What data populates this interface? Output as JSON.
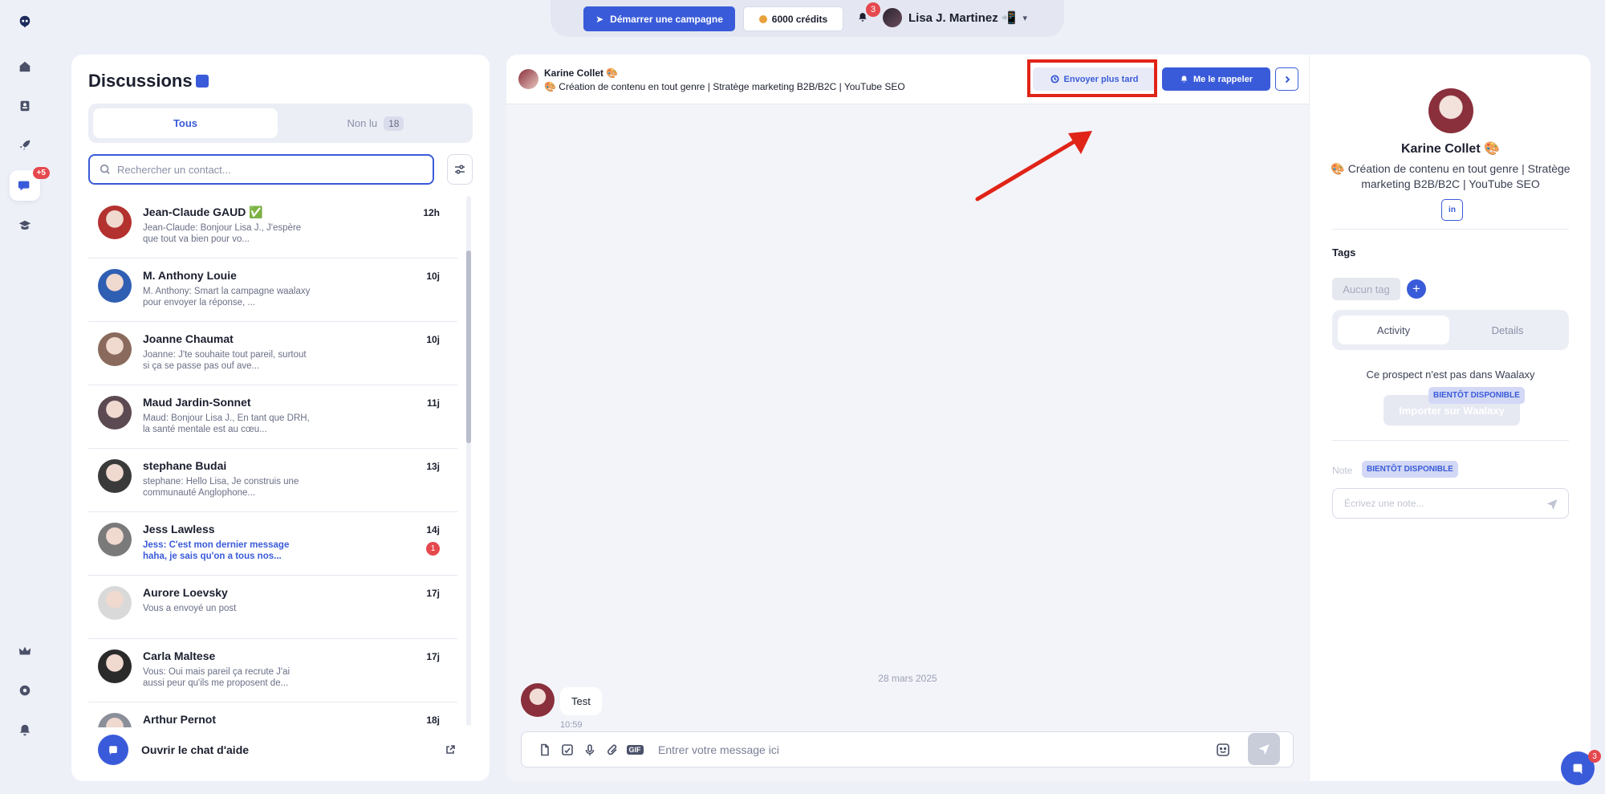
{
  "topbar": {
    "campaign_label": "Démarrer une campagne",
    "credits_label": "6000 crédits",
    "notifications_count": "3",
    "user_name": "Lisa J. Martinez 📲"
  },
  "sidebar": {
    "messages_badge": "+5"
  },
  "discussions": {
    "title": "Discussions",
    "tab_all": "Tous",
    "tab_unread": "Non lu",
    "unread_count": "18",
    "search_placeholder": "Rechercher un contact...",
    "items": [
      {
        "name": "Jean-Claude GAUD ✅",
        "time": "12h",
        "preview": "Jean-Claude: Bonjour Lisa J., J'espère que tout va bien pour vo...",
        "unread": false,
        "badge": "",
        "color": "#b3312f"
      },
      {
        "name": "M. Anthony Louie",
        "time": "10j",
        "preview": "M. Anthony: Smart la campagne waalaxy pour envoyer la réponse, ...",
        "unread": false,
        "badge": "",
        "color": "#2f5fb3"
      },
      {
        "name": "Joanne Chaumat",
        "time": "10j",
        "preview": "Joanne: J'te souhaite tout pareil, surtout si ça se passe pas ouf ave...",
        "unread": false,
        "badge": "",
        "color": "#8a6a5c"
      },
      {
        "name": "Maud Jardin-Sonnet",
        "time": "11j",
        "preview": "Maud: Bonjour Lisa J., En tant que DRH, la santé mentale est au cœu...",
        "unread": false,
        "badge": "",
        "color": "#5c4a52"
      },
      {
        "name": "stephane Budai",
        "time": "13j",
        "preview": "stephane: Hello Lisa, Je construis une communauté Anglophone...",
        "unread": false,
        "badge": "",
        "color": "#3a3a3a"
      },
      {
        "name": "Jess Lawless",
        "time": "14j",
        "preview": "Jess: C'est mon dernier message haha, je sais qu'on a tous nos...",
        "unread": true,
        "badge": "1",
        "color": "#7a7a7a"
      },
      {
        "name": "Aurore Loevsky",
        "time": "17j",
        "preview": "Vous a envoyé un post",
        "unread": false,
        "badge": "",
        "color": "#d9d9d9"
      },
      {
        "name": "Carla Maltese",
        "time": "17j",
        "preview": "Vous: Oui mais pareil ça recrute J'ai aussi peur qu'ils me proposent de...",
        "unread": false,
        "badge": "",
        "color": "#2a2a2a"
      },
      {
        "name": "Arthur Pernot",
        "time": "18j",
        "preview": "",
        "unread": false,
        "badge": "",
        "color": "#8a8f9a"
      }
    ],
    "help_label": "Ouvrir le chat d'aide"
  },
  "chat": {
    "contact_name": "Karine Collet 🎨",
    "contact_headline": "🎨 Création de contenu en tout genre | Stratège marketing B2B/B2C | YouTube SEO",
    "send_later_label": "Envoyer plus tard",
    "remind_label": "Me le rappeler",
    "date_separator": "28 mars 2025",
    "messages": [
      {
        "text": "Test",
        "time": "10:59"
      }
    ],
    "composer_placeholder": "Entrer votre message ici",
    "gif_label": "GIF"
  },
  "profile": {
    "name": "Karine Collet 🎨",
    "bio": "🎨 Création de contenu en tout genre | Stratège marketing B2B/B2C | YouTube SEO",
    "linkedin_label": "in",
    "tags_title": "Tags",
    "no_tag_label": "Aucun tag",
    "add_tag_label": "+",
    "tab_activity": "Activity",
    "tab_details": "Details",
    "not_in_waalaxy": "Ce prospect n'est pas dans Waalaxy",
    "import_label": "Importer sur Waalaxy",
    "coming_soon_label": "BIENTÔT DISPONIBLE",
    "note_label": "Note",
    "note_placeholder": "Écrivez une note..."
  },
  "fab": {
    "badge": "3"
  },
  "colors": {
    "accent": "#3a5bd9",
    "danger": "#e5484d",
    "highlight": "#e02418",
    "background": "#eef0f8"
  }
}
